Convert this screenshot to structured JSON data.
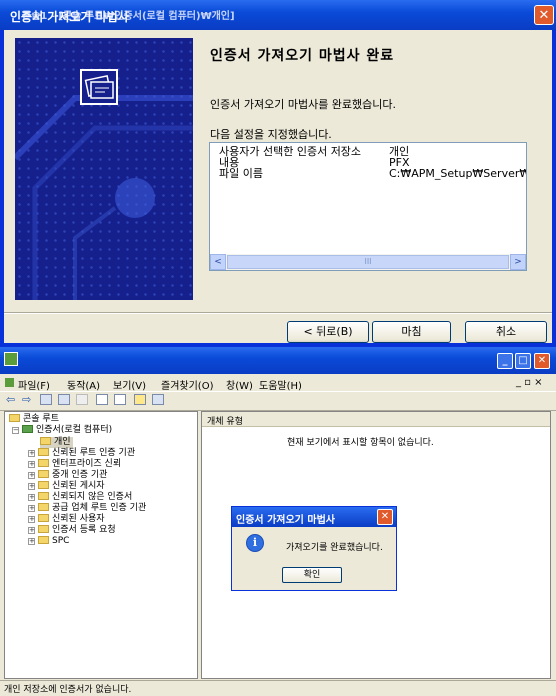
{
  "wizard": {
    "title": "인증서 가져오기 마법사",
    "close_glyph": "✕",
    "heading": "인증서 가져오기 마법사 완료",
    "message": "인증서 가져오기 마법사를 완료했습니다.",
    "settings_label": "다음 설정을 지정했습니다.",
    "settings": [
      {
        "key": "사용자가 선택한 인증서 저장소",
        "value": "개인"
      },
      {
        "key": "내용",
        "value": "PFX"
      },
      {
        "key": "파일 이름",
        "value": "C:₩APM_Setup₩Server₩"
      }
    ],
    "scroll_left": "<",
    "scroll_right": ">",
    "scroll_thumb": "III",
    "buttons": {
      "back": "< 뒤로(B)",
      "finish": "마침",
      "cancel": "취소"
    }
  },
  "mmc": {
    "title": "콘솔1 - [콘솔 루트₩인증서(로컬 컴퓨터)₩개인]",
    "title_buttons": {
      "minimize": "_",
      "maximize": "□",
      "close": "✕"
    },
    "menu": [
      "파일(F)",
      "동작(A)",
      "보기(V)",
      "즐겨찾기(O)",
      "창(W)",
      "도움말(H)"
    ],
    "menu_right": "_ ▫ ×",
    "tree": {
      "root": "콘솔 루트",
      "certs": "인증서(로컬 컴퓨터)",
      "items": [
        "개인",
        "신뢰된 루트 인증 기관",
        "엔터프라이즈 신뢰",
        "중개 인증 기관",
        "신뢰된 게시자",
        "신뢰되지 않은 인증서",
        "공급 업체 루트 인증 기관",
        "신뢰된 사용자",
        "인증서 등록 요청",
        "SPC"
      ]
    },
    "column_header": "개체 유형",
    "empty_message": "현재 보기에서 표시할 항목이 없습니다.",
    "status": "개인 저장소에 인증서가 없습니다."
  },
  "dialog": {
    "title": "인증서 가져오기 마법사",
    "close_glyph": "✕",
    "icon_glyph": "i",
    "message": "가져오기를 완료했습니다.",
    "ok": "확인"
  }
}
